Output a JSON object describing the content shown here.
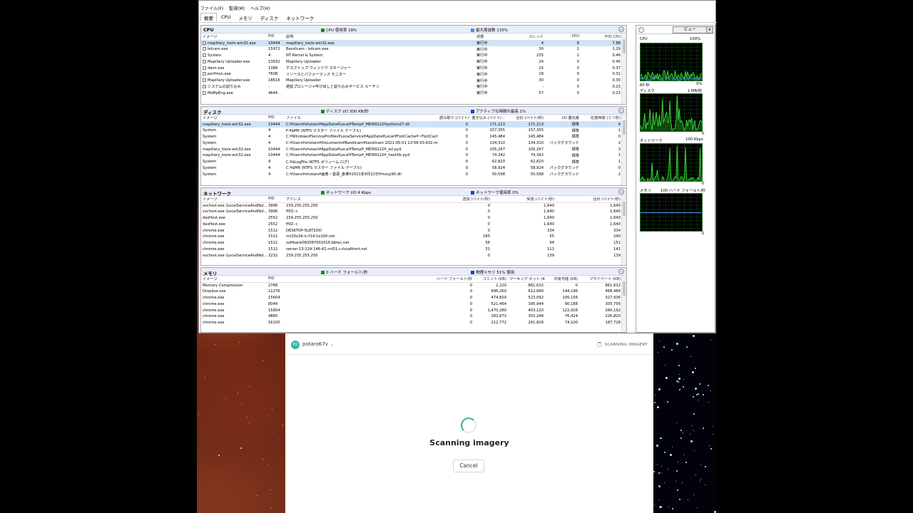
{
  "menubar": [
    "ファイル(F)",
    "監視(M)",
    "ヘルプ(H)"
  ],
  "tabs": [
    "概要",
    "CPU",
    "メモリ",
    "ディスク",
    "ネットワーク"
  ],
  "colors": {
    "cpu": "#1a8a1a",
    "disk": "#1a8a1a",
    "network": "#1a8a1a",
    "memory": "#1a8a1a",
    "blue": "#1a3fcf"
  },
  "cpu": {
    "title": "CPU",
    "stat1": "CPU 使用率 18%",
    "stat2": "最大周波数 133%",
    "columns": [
      "イメージ",
      "PID",
      "説明",
      "状態",
      "スレッド",
      "CPU",
      "平均 CPU"
    ],
    "rows": [
      [
        "mapillary_tools-win32.exe",
        "10444",
        "mapillary_tools-win32.exe",
        "実行中",
        "4",
        "8",
        "7.88"
      ],
      [
        "bdcam.exe",
        "15972",
        "Bandicam - bdcam.exe",
        "実行中",
        "30",
        "1",
        "1.29"
      ],
      [
        "System",
        "4",
        "NT Kernel & System",
        "実行中",
        "235",
        "1",
        "0.46"
      ],
      [
        "Mapillary Uploader.exe",
        "13632",
        "Mapillary Uploader",
        "実行中",
        "24",
        "0",
        "0.45"
      ],
      [
        "dwm.exe",
        "1368",
        "デスクトップ ウィンドウ マネージャー",
        "実行中",
        "15",
        "0",
        "0.37"
      ],
      [
        "perfmon.exe",
        "7608",
        "リソースとパフォーマンス モニター",
        "実行中",
        "18",
        "0",
        "0.31"
      ],
      [
        "Mapillary Uploader.exe",
        "18616",
        "Mapillary Uploader",
        "実行中",
        "30",
        "0",
        "0.30"
      ],
      [
        "システムの割り込み",
        "-",
        "遅延プロシージャ呼び出しと割り込みサービス ルーチン",
        "実行中",
        "-",
        "0",
        "0.23"
      ],
      [
        "MsMpEng.exe",
        "4644",
        "",
        "実行中",
        "57",
        "0",
        "0.23"
      ]
    ]
  },
  "disk": {
    "title": "ディスク",
    "stat1": "ディスク I/O 300 KB/秒",
    "stat2": "アクティブな時間の最高 1%",
    "columns": [
      "イメージ",
      "PID",
      "ファイル",
      "読み取り (バイト/...",
      "書き込み (バイト/...",
      "合計 (バイト/秒)",
      "I/O 優先度",
      "応答時間 (ミリ秒)"
    ],
    "rows": [
      [
        "mapillary_tools-win32.exe",
        "10444",
        "C:¥Users¥shotaro¥AppData¥Local¥Temp¥_MEI99122¥python27.dll",
        "0",
        "171,213",
        "171,213",
        "標準",
        "4"
      ],
      [
        "System",
        "4",
        "F:¥$Mft (NTFS マスター ファイル テーブル)",
        "0",
        "157,355",
        "157,355",
        "標準",
        "1"
      ],
      [
        "System",
        "4",
        "C:¥Windows¥ServiceProfiles¥LocalService¥AppData¥Local¥FontCache¥~FontCach...",
        "0",
        "145,484",
        "145,484",
        "標準",
        "0"
      ],
      [
        "System",
        "4",
        "C:¥Users¥shotaro¥Documents¥Bandicam¥bandicam 2021-05-01 13-58-03-632.mp4",
        "0",
        "134,310",
        "134,310",
        "バックグラウンド",
        "2"
      ],
      [
        "mapillary_tools-win32.exe",
        "10444",
        "C:¥Users¥shotaro¥AppData¥Local¥Temp¥_MEI99122¥_ssl.pyd",
        "0",
        "105,267",
        "105,267",
        "標準",
        "3"
      ],
      [
        "mapillary_tools-win32.exe",
        "10444",
        "C:¥Users¥shotaro¥AppData¥Local¥Temp¥_MEI99122¥_hashlib.pyd",
        "0",
        "74,342",
        "74,342",
        "標準",
        "1"
      ],
      [
        "System",
        "4",
        "C:¥$LogFile (NTFS ボリューム ログ)",
        "0",
        "62,820",
        "62,820",
        "標準",
        "1"
      ],
      [
        "System",
        "4",
        "C:¥$Mft (NTFS マスター ファイル テーブル)",
        "0",
        "58,924",
        "58,924",
        "バックグラウンド",
        "0"
      ],
      [
        "System",
        "4",
        "C:¥Users¥shotaro¥画像・音源_倉庫¥2021年9月22日¥mscp90.dll",
        "0",
        "50,598",
        "50,598",
        "バックグラウンド",
        "2"
      ]
    ]
  },
  "network": {
    "title": "ネットワーク",
    "stat1": "ネットワーク I/O 4 Kbps",
    "stat2": "ネットワーク使用率 0%",
    "columns": [
      "イメージ",
      "PID",
      "アドレス",
      "送信 (バイト/秒)",
      "受信 (バイト/秒)",
      "合計 (バイト/秒)"
    ],
    "rows": [
      [
        "svchost.exe (LocalServiceAndNoI...",
        "3996",
        "239.255.255.250",
        "0",
        "1,640",
        "1,640"
      ],
      [
        "svchost.exe (LocalServiceAndNoI...",
        "3996",
        "ff02::c",
        "0",
        "1,640",
        "1,640"
      ],
      [
        "dasHost.exe",
        "2552",
        "239.255.255.250",
        "0",
        "1,640",
        "1,640"
      ],
      [
        "dasHost.exe",
        "2552",
        "ff02::c",
        "0",
        "1,640",
        "1,640"
      ],
      [
        "chrome.exe",
        "1512",
        "DESKTOP-5L8T2OO",
        "0",
        "334",
        "334"
      ],
      [
        "chrome.exe",
        "1512",
        "nrt20s18-in-f14.1e100.net",
        "185",
        "55",
        "240"
      ],
      [
        "chrome.exe",
        "1512",
        "softbank060087001016.bbtec.net",
        "56",
        "94",
        "151"
      ],
      [
        "chrome.exe",
        "1512",
        "server-13-224-146-62.nrt51.r.cloudfront.net",
        "31",
        "111",
        "141"
      ],
      [
        "svchost.exe (LocalServiceAndNoI...",
        "3232",
        "239.255.255.250",
        "0",
        "139",
        "139"
      ]
    ]
  },
  "memory": {
    "title": "メモリ",
    "stat1": "0 ハード フォールト/秒",
    "stat2": "物理メモリ 51% 使用",
    "columns": [
      "イメージ",
      "PID",
      "ハード フォールト/秒",
      "コミット (KB)",
      "ワーキング セット (KB)",
      "共有可能 (KB)",
      "プライベート (KB)"
    ],
    "rows": [
      [
        "Memory Compression",
        "2768",
        "0",
        "2,220",
        "861,632",
        "0",
        "861,632"
      ],
      [
        "Dropbox.exe",
        "11276",
        "0",
        "696,260",
        "612,680",
        "144,196",
        "468,484"
      ],
      [
        "chrome.exe",
        "15604",
        "0",
        "474,820",
        "523,092",
        "195,156",
        "327,936"
      ],
      [
        "chrome.exe",
        "8044",
        "0",
        "521,464",
        "395,944",
        "90,188",
        "305,756"
      ],
      [
        "chrome.exe",
        "15804",
        "0",
        "1,470,280",
        "403,120",
        "122,928",
        "280,192"
      ],
      [
        "chrome.exe",
        "4860",
        "0",
        "282,672",
        "303,244",
        "76,424",
        "226,820"
      ],
      [
        "chrome.exe",
        "16100",
        "0",
        "212,772",
        "261,828",
        "74,100",
        "187,728"
      ]
    ]
  },
  "right_pane": {
    "view_label": "ビュー",
    "cpu_label": "CPU",
    "cpu_max": "100%",
    "cpu_time": "60 秒",
    "cpu_min": "0%",
    "disk_label": "ディスク",
    "disk_max": "1 MB/秒",
    "disk_min": "0",
    "net_label": "ネットワーク",
    "net_max": "100 Kbps",
    "net_min": "0",
    "mem_label": "メモリ",
    "mem_max": "100 ハード フォールト/秒",
    "mem_min": "0",
    "memory_blue_level": 0.51
  },
  "mapillary": {
    "avatar": "PO",
    "username": "potaro67v",
    "status": "SCANNING IMAGERY",
    "heading": "Scanning imagery",
    "cancel": "Cancel"
  }
}
